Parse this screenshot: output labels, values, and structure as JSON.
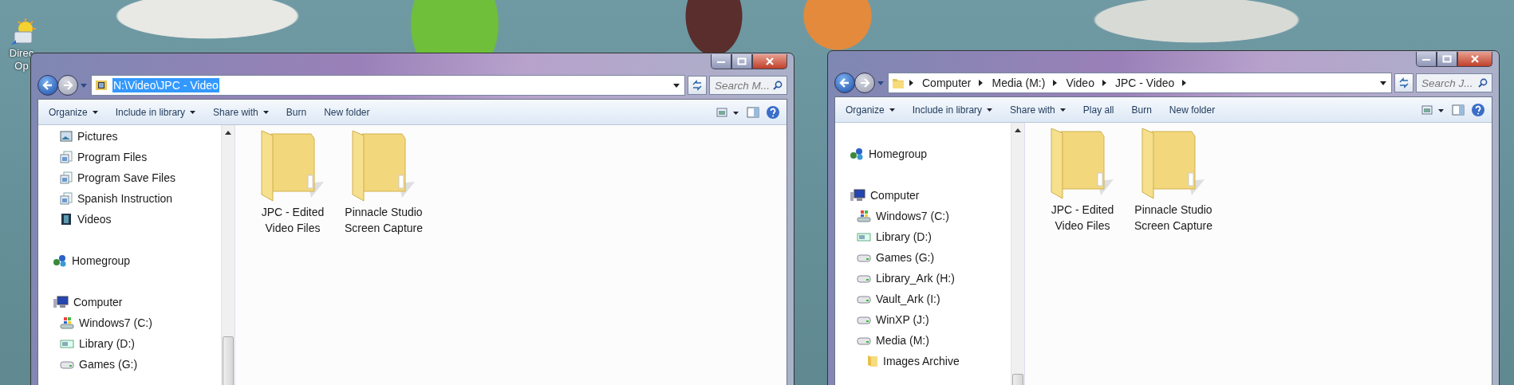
{
  "desktop_icon": {
    "label_lines": [
      "Direc",
      "Op"
    ]
  },
  "windows": [
    {
      "address": {
        "kind": "path",
        "text": "N:\\Video\\JPC - Video",
        "selected": true
      },
      "search": {
        "placeholder": "Search M..."
      },
      "toolbar": [
        {
          "label": "Organize",
          "dropdown": true
        },
        {
          "label": "Include in library",
          "dropdown": true
        },
        {
          "label": "Share with",
          "dropdown": true
        },
        {
          "label": "Burn",
          "dropdown": false
        },
        {
          "label": "New folder",
          "dropdown": false
        }
      ],
      "nav": [
        {
          "children": [
            {
              "label": "Pictures",
              "kind": "pictures"
            },
            {
              "label": "Program Files",
              "kind": "library"
            },
            {
              "label": "Program Save Files",
              "kind": "library"
            },
            {
              "label": "Spanish Instruction",
              "kind": "library"
            },
            {
              "label": "Videos",
              "kind": "videos"
            }
          ]
        },
        {
          "label": "Homegroup",
          "kind": "homegroup"
        },
        {
          "label": "Computer",
          "kind": "computer",
          "children": [
            {
              "label": "Windows7 (C:)",
              "kind": "windows-drive"
            },
            {
              "label": "Library (D:)",
              "kind": "network-drive"
            },
            {
              "label": "Games (G:)",
              "kind": "drive"
            }
          ]
        }
      ],
      "folders": [
        {
          "label": "JPC - Edited Video Files"
        },
        {
          "label": "Pinnacle Studio Screen Capture"
        }
      ]
    },
    {
      "address": {
        "kind": "breadcrumb",
        "segments": [
          "Computer",
          "Media (M:)",
          "Video",
          "JPC - Video"
        ]
      },
      "search": {
        "placeholder": "Search J..."
      },
      "toolbar": [
        {
          "label": "Organize",
          "dropdown": true
        },
        {
          "label": "Include in library",
          "dropdown": true
        },
        {
          "label": "Share with",
          "dropdown": true
        },
        {
          "label": "Play all",
          "dropdown": false
        },
        {
          "label": "Burn",
          "dropdown": false
        },
        {
          "label": "New folder",
          "dropdown": false
        }
      ],
      "nav": [
        {
          "label": "Homegroup",
          "kind": "homegroup"
        },
        {
          "label": "Computer",
          "kind": "computer",
          "children": [
            {
              "label": "Windows7 (C:)",
              "kind": "windows-drive"
            },
            {
              "label": "Library (D:)",
              "kind": "network-drive"
            },
            {
              "label": "Games (G:)",
              "kind": "drive"
            },
            {
              "label": "Library_Ark (H:)",
              "kind": "drive"
            },
            {
              "label": "Vault_Ark (I:)",
              "kind": "drive"
            },
            {
              "label": "WinXP (J:)",
              "kind": "drive"
            },
            {
              "label": "Media (M:)",
              "kind": "drive",
              "children": [
                {
                  "label": "Images Archive",
                  "kind": "folder"
                }
              ]
            }
          ]
        }
      ],
      "folders": [
        {
          "label": "JPC - Edited Video Files"
        },
        {
          "label": "Pinnacle Studio Screen Capture"
        }
      ]
    }
  ]
}
